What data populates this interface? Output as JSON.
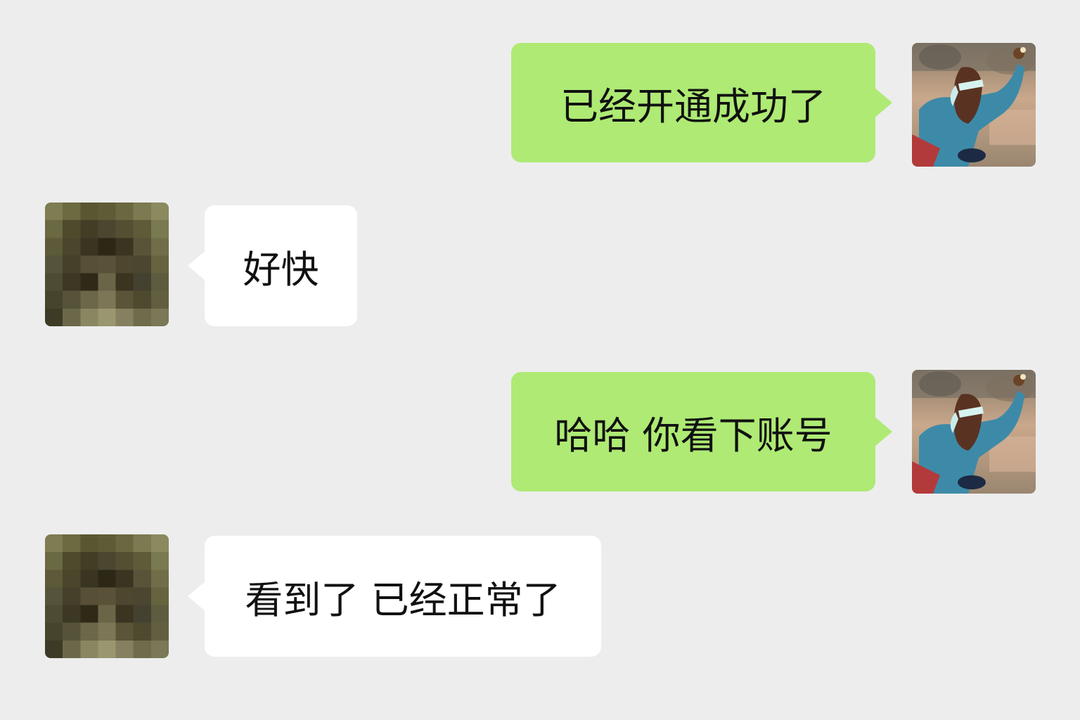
{
  "conversation": {
    "messages": [
      {
        "sender": "me",
        "text": "已经开通成功了",
        "avatar": "user-avatar-photo"
      },
      {
        "sender": "contact",
        "text": "好快",
        "avatar": "contact-avatar-pixelated"
      },
      {
        "sender": "me",
        "text": "哈哈 你看下账号",
        "avatar": "user-avatar-photo"
      },
      {
        "sender": "contact",
        "text": "看到了 已经正常了",
        "avatar": "contact-avatar-pixelated"
      }
    ]
  },
  "colors": {
    "background": "#ededed",
    "outgoing_bubble": "#aeea74",
    "incoming_bubble": "#ffffff",
    "text": "#111111"
  }
}
